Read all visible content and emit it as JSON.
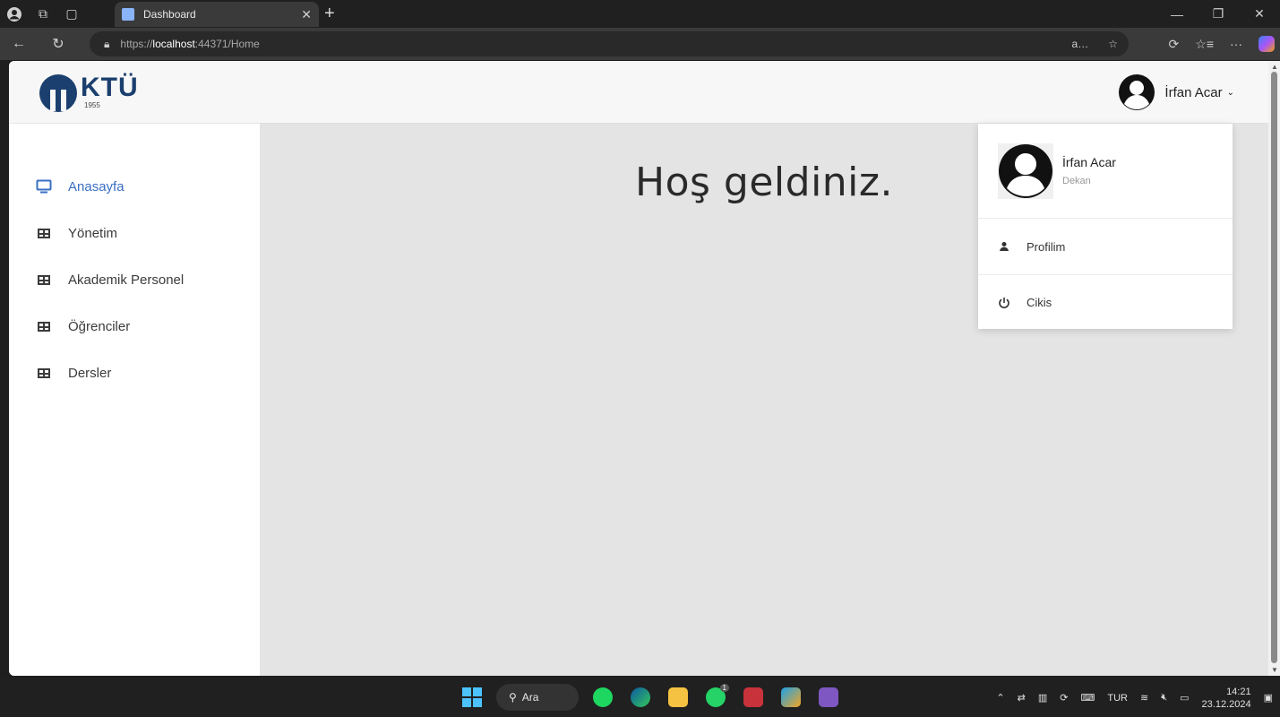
{
  "browser": {
    "tab_title": "Dashboard",
    "url_prefix": "https://",
    "url_host": "localhost",
    "url_rest": ":44371/Home"
  },
  "sidebar": {
    "logo_text": "KTÜ",
    "logo_year": "1955",
    "items": [
      {
        "label": "Anasayfa",
        "icon": "monitor-icon",
        "active": true
      },
      {
        "label": "Yönetim",
        "icon": "table-icon"
      },
      {
        "label": "Akademik Personel",
        "icon": "table-icon"
      },
      {
        "label": "Öğrenciler",
        "icon": "table-icon"
      },
      {
        "label": "Dersler",
        "icon": "table-icon"
      }
    ]
  },
  "topbar": {
    "user_name": "İrfan Acar"
  },
  "main": {
    "welcome": "Hoş geldiniz."
  },
  "dropdown": {
    "name": "İrfan Acar",
    "role": "Dekan",
    "items": [
      {
        "label": "Profilim",
        "icon": "user-icon"
      },
      {
        "label": "Cikis",
        "icon": "power-icon"
      }
    ]
  },
  "taskbar": {
    "search_label": "Ara",
    "language": "TUR",
    "time": "14:21",
    "date": "23.12.2024",
    "whatsapp_badge": "1"
  },
  "colors": {
    "accent": "#3a6fc4",
    "logo": "#1b3f6e",
    "content_bg": "#e4e4e4"
  }
}
